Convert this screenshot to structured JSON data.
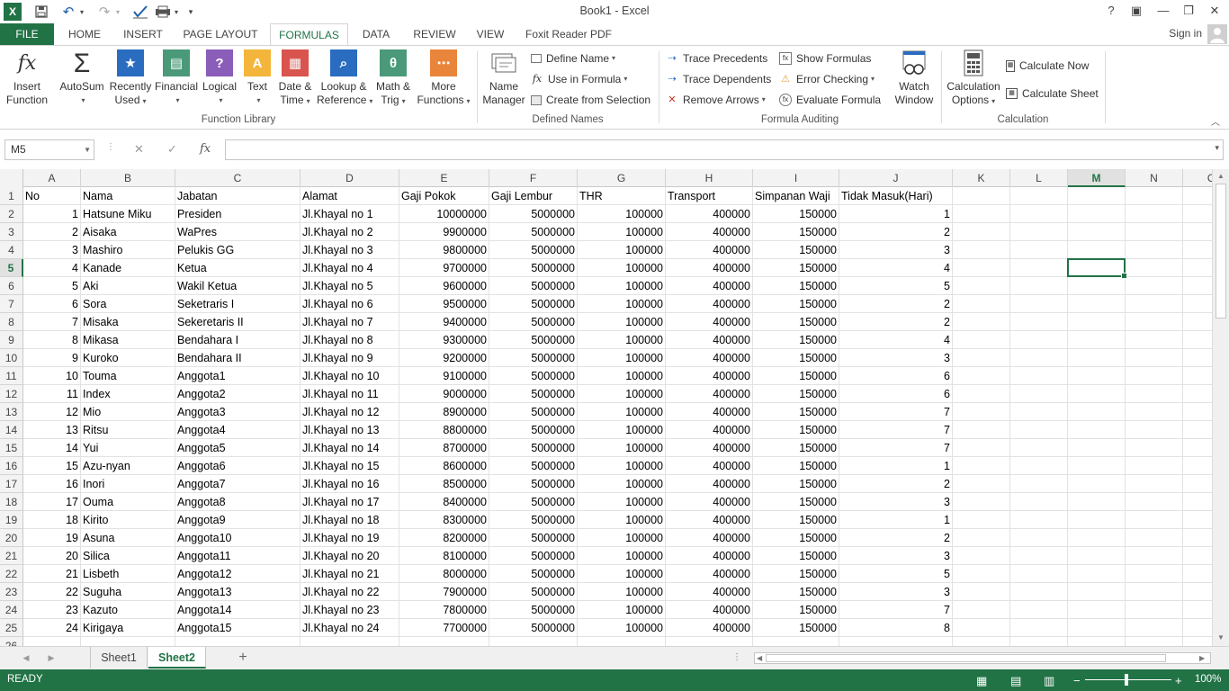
{
  "window": {
    "title": "Book1 - Excel",
    "buttons": {
      "help": "?",
      "restore": "▣",
      "minimize": "—",
      "maximize": "❐",
      "close": "✕"
    }
  },
  "quick_access": {
    "excel_logo": "X",
    "save": "💾",
    "undo": "↶",
    "redo": "↷",
    "customize": "▾"
  },
  "tabs": [
    {
      "label": "FILE"
    },
    {
      "label": "HOME"
    },
    {
      "label": "INSERT"
    },
    {
      "label": "PAGE LAYOUT"
    },
    {
      "label": "FORMULAS"
    },
    {
      "label": "DATA"
    },
    {
      "label": "REVIEW"
    },
    {
      "label": "VIEW"
    },
    {
      "label": "Foxit Reader PDF"
    }
  ],
  "active_tab": "FORMULAS",
  "signin_label": "Sign in",
  "ribbon": {
    "function_library": {
      "group_label": "Function Library",
      "buttons": [
        {
          "line1": "Insert",
          "line2": "Function",
          "glyph": "fx"
        },
        {
          "line1": "AutoSum",
          "line2": "",
          "glyph": "Σ"
        },
        {
          "line1": "Recently",
          "line2": "Used",
          "glyph": "★"
        },
        {
          "line1": "Financial",
          "line2": "",
          "glyph": "▤"
        },
        {
          "line1": "Logical",
          "line2": "",
          "glyph": "?"
        },
        {
          "line1": "Text",
          "line2": "",
          "glyph": "A"
        },
        {
          "line1": "Date &",
          "line2": "Time",
          "glyph": "▦"
        },
        {
          "line1": "Lookup &",
          "line2": "Reference",
          "glyph": "⌕"
        },
        {
          "line1": "Math &",
          "line2": "Trig",
          "glyph": "θ"
        },
        {
          "line1": "More",
          "line2": "Functions",
          "glyph": "⋯"
        }
      ]
    },
    "defined_names": {
      "group_label": "Defined Names",
      "name_manager": {
        "line1": "Name",
        "line2": "Manager"
      },
      "define_name": "Define Name",
      "use_in_formula": "Use in Formula",
      "create_from_selection": "Create from Selection"
    },
    "formula_auditing": {
      "group_label": "Formula Auditing",
      "trace_precedents": "Trace Precedents",
      "trace_dependents": "Trace Dependents",
      "remove_arrows": "Remove Arrows",
      "show_formulas": "Show Formulas",
      "error_checking": "Error Checking",
      "evaluate_formula": "Evaluate Formula",
      "watch_window": {
        "line1": "Watch",
        "line2": "Window"
      }
    },
    "calculation": {
      "group_label": "Calculation",
      "calculation_options": {
        "line1": "Calculation",
        "line2": "Options"
      },
      "calculate_now": "Calculate Now",
      "calculate_sheet": "Calculate Sheet"
    }
  },
  "formula_bar": {
    "name_box": "M5",
    "cancel": "✕",
    "enter": "✓",
    "fx": "fx",
    "value": ""
  },
  "columns": [
    "A",
    "B",
    "C",
    "D",
    "E",
    "F",
    "G",
    "H",
    "I",
    "J",
    "K",
    "L",
    "M",
    "N",
    "O"
  ],
  "selected_column": "M",
  "selected_row": "5",
  "row_numbers": [
    "1",
    "2",
    "3",
    "4",
    "5",
    "6",
    "7",
    "8",
    "9",
    "10",
    "11",
    "12",
    "13",
    "14",
    "15",
    "16",
    "17",
    "18",
    "19",
    "20",
    "21",
    "22",
    "23",
    "24",
    "25",
    "26"
  ],
  "headers": [
    "No",
    "Nama",
    "Jabatan",
    "Alamat",
    "Gaji Pokok",
    "Gaji Lembur",
    "THR",
    "Transport",
    "Simpanan Waji",
    "Tidak Masuk(Hari)"
  ],
  "rows": [
    [
      "1",
      "Hatsune Miku",
      "Presiden",
      "Jl.Khayal no 1",
      "10000000",
      "5000000",
      "100000",
      "400000",
      "150000",
      "1"
    ],
    [
      "2",
      "Aisaka",
      "WaPres",
      "Jl.Khayal no 2",
      "9900000",
      "5000000",
      "100000",
      "400000",
      "150000",
      "2"
    ],
    [
      "3",
      "Mashiro",
      "Pelukis GG",
      "Jl.Khayal no 3",
      "9800000",
      "5000000",
      "100000",
      "400000",
      "150000",
      "3"
    ],
    [
      "4",
      "Kanade",
      "Ketua",
      "Jl.Khayal no 4",
      "9700000",
      "5000000",
      "100000",
      "400000",
      "150000",
      "4"
    ],
    [
      "5",
      "Aki",
      "Wakil Ketua",
      "Jl.Khayal no 5",
      "9600000",
      "5000000",
      "100000",
      "400000",
      "150000",
      "5"
    ],
    [
      "6",
      "Sora",
      "Seketraris I",
      "Jl.Khayal no 6",
      "9500000",
      "5000000",
      "100000",
      "400000",
      "150000",
      "2"
    ],
    [
      "7",
      "Misaka",
      "Sekeretaris II",
      "Jl.Khayal no 7",
      "9400000",
      "5000000",
      "100000",
      "400000",
      "150000",
      "2"
    ],
    [
      "8",
      "Mikasa",
      "Bendahara I",
      "Jl.Khayal no 8",
      "9300000",
      "5000000",
      "100000",
      "400000",
      "150000",
      "4"
    ],
    [
      "9",
      "Kuroko",
      "Bendahara II",
      "Jl.Khayal no 9",
      "9200000",
      "5000000",
      "100000",
      "400000",
      "150000",
      "3"
    ],
    [
      "10",
      "Touma",
      "Anggota1",
      "Jl.Khayal no 10",
      "9100000",
      "5000000",
      "100000",
      "400000",
      "150000",
      "6"
    ],
    [
      "11",
      "Index",
      "Anggota2",
      "Jl.Khayal no 11",
      "9000000",
      "5000000",
      "100000",
      "400000",
      "150000",
      "6"
    ],
    [
      "12",
      "Mio",
      "Anggota3",
      "Jl.Khayal no 12",
      "8900000",
      "5000000",
      "100000",
      "400000",
      "150000",
      "7"
    ],
    [
      "13",
      "Ritsu",
      "Anggota4",
      "Jl.Khayal no 13",
      "8800000",
      "5000000",
      "100000",
      "400000",
      "150000",
      "7"
    ],
    [
      "14",
      "Yui",
      "Anggota5",
      "Jl.Khayal no 14",
      "8700000",
      "5000000",
      "100000",
      "400000",
      "150000",
      "7"
    ],
    [
      "15",
      "Azu-nyan",
      "Anggota6",
      "Jl.Khayal no 15",
      "8600000",
      "5000000",
      "100000",
      "400000",
      "150000",
      "1"
    ],
    [
      "16",
      "Inori",
      "Anggota7",
      "Jl.Khayal no 16",
      "8500000",
      "5000000",
      "100000",
      "400000",
      "150000",
      "2"
    ],
    [
      "17",
      "Ouma",
      "Anggota8",
      "Jl.Khayal no 17",
      "8400000",
      "5000000",
      "100000",
      "400000",
      "150000",
      "3"
    ],
    [
      "18",
      "Kirito",
      "Anggota9",
      "Jl.Khayal no 18",
      "8300000",
      "5000000",
      "100000",
      "400000",
      "150000",
      "1"
    ],
    [
      "19",
      "Asuna",
      "Anggota10",
      "Jl.Khayal no 19",
      "8200000",
      "5000000",
      "100000",
      "400000",
      "150000",
      "2"
    ],
    [
      "20",
      "Silica",
      "Anggota11",
      "Jl.Khayal no 20",
      "8100000",
      "5000000",
      "100000",
      "400000",
      "150000",
      "3"
    ],
    [
      "21",
      "Lisbeth",
      "Anggota12",
      "Jl.Khayal no 21",
      "8000000",
      "5000000",
      "100000",
      "400000",
      "150000",
      "5"
    ],
    [
      "22",
      "Suguha",
      "Anggota13",
      "Jl.Khayal no 22",
      "7900000",
      "5000000",
      "100000",
      "400000",
      "150000",
      "3"
    ],
    [
      "23",
      "Kazuto",
      "Anggota14",
      "Jl.Khayal no 23",
      "7800000",
      "5000000",
      "100000",
      "400000",
      "150000",
      "7"
    ],
    [
      "24",
      "Kirigaya",
      "Anggota15",
      "Jl.Khayal no 24",
      "7700000",
      "5000000",
      "100000",
      "400000",
      "150000",
      "8"
    ]
  ],
  "sheet_tabs": [
    {
      "label": "Sheet1",
      "active": false
    },
    {
      "label": "Sheet2",
      "active": true
    }
  ],
  "add_sheet": "+",
  "status": {
    "ready": "READY",
    "zoom": "100%"
  },
  "colors": {
    "accent": "#217346",
    "gridline": "#e2e2e2",
    "header_bg": "#f3f3f3"
  }
}
